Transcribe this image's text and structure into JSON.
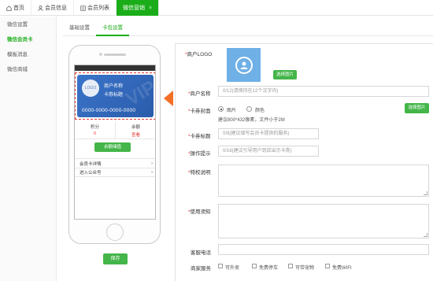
{
  "tabs": [
    {
      "label": "首页",
      "icon": "home-icon"
    },
    {
      "label": "会员信息",
      "icon": "user-icon"
    },
    {
      "label": "会员列表",
      "icon": "list-icon"
    },
    {
      "label": "微信营销",
      "active": true,
      "close": "×"
    }
  ],
  "sidebar": {
    "items": [
      {
        "label": "微信设置"
      },
      {
        "label": "微信会员卡",
        "active": true
      },
      {
        "label": "模板消息"
      },
      {
        "label": "微信商城"
      }
    ]
  },
  "subtabs": [
    {
      "label": "基础设置"
    },
    {
      "label": "卡包设置",
      "active": true
    }
  ],
  "phone": {
    "card": {
      "logo": "LOGO",
      "name": "商户名称",
      "title": "卡券标题",
      "number": "0000-0000-0000-0000",
      "watermark": "VIP"
    },
    "stats": [
      {
        "label": "积分",
        "value": "0"
      },
      {
        "label": "余额",
        "value": "查看"
      }
    ],
    "recharge": "余额储值",
    "menu": [
      {
        "label": "会员卡详情",
        "arrow": "›"
      },
      {
        "label": "进入公众号",
        "arrow": "›"
      }
    ]
  },
  "form": {
    "logo_label": "商户LOGO",
    "logo_button": "选择图片",
    "name_label": "商户名称",
    "name_placeholder": "0/12(请保持在12个汉字内)",
    "cover_label": "卡券封面",
    "cover_opt_image": "图片",
    "cover_opt_color": "颜色",
    "cover_hint": "建议800*432像素，文件小于2M",
    "cover_button": "选择图片",
    "title_label": "卡券标题",
    "title_placeholder": "0/9(建议填写会员卡提供的服务)",
    "tip_label": "操作提示",
    "tip_placeholder": "0/16(建议引导用户到店出示卡券)",
    "privilege_label": "特权说明",
    "notice_label": "使用须知",
    "phone_label": "客服电话",
    "service_label": "商家服务",
    "services": [
      {
        "label": "可外卖"
      },
      {
        "label": "免费停车"
      },
      {
        "label": "可带宠物"
      },
      {
        "label": "免费WIFI"
      }
    ]
  },
  "save_label": "保存"
}
